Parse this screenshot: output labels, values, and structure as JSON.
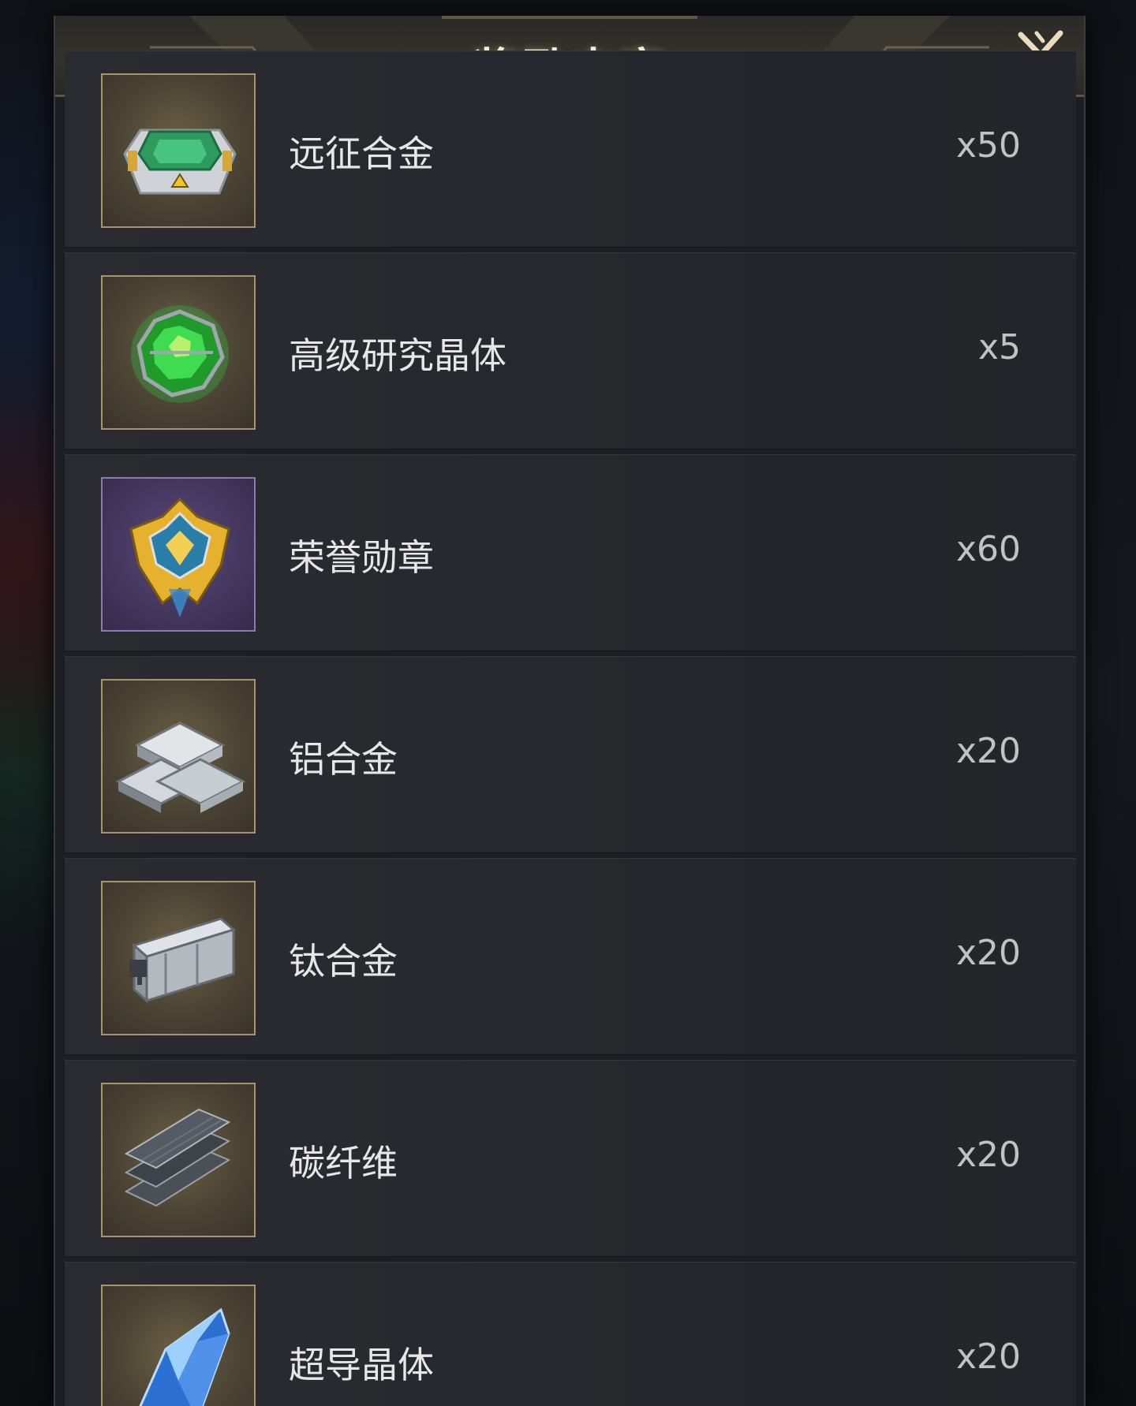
{
  "dialog": {
    "title": "奖励内容",
    "close_icon": "close-x-icon"
  },
  "rewards": [
    {
      "name": "远征合金",
      "qty": "x50",
      "icon": "expedition-alloy-icon",
      "frame": "gold"
    },
    {
      "name": "高级研究晶体",
      "qty": "x5",
      "icon": "advanced-research-crystal-icon",
      "frame": "gold"
    },
    {
      "name": "荣誉勋章",
      "qty": "x60",
      "icon": "honor-medal-icon",
      "frame": "purple"
    },
    {
      "name": "铝合金",
      "qty": "x20",
      "icon": "aluminum-alloy-icon",
      "frame": "gold"
    },
    {
      "name": "钛合金",
      "qty": "x20",
      "icon": "titanium-alloy-icon",
      "frame": "gold"
    },
    {
      "name": "碳纤维",
      "qty": "x20",
      "icon": "carbon-fiber-icon",
      "frame": "gold"
    },
    {
      "name": "超导晶体",
      "qty": "x20",
      "icon": "superconductor-crystal-icon",
      "frame": "gold"
    }
  ],
  "colors": {
    "title_text": "#f3ecdc",
    "gold_frame": "#a8946a",
    "purple_frame": "#8c7bb0",
    "row_bg": "#26282d"
  }
}
